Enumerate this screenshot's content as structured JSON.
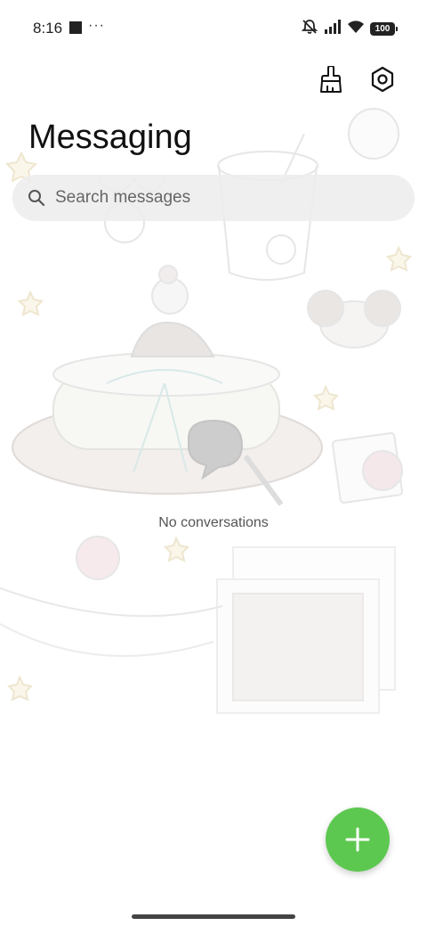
{
  "status_bar": {
    "time": "8:16",
    "more_indicator": "···",
    "battery": "100",
    "icons": [
      "notification-square-icon",
      "mute-icon",
      "signal-icon",
      "wifi-icon",
      "battery-icon"
    ]
  },
  "header": {
    "title": "Messaging",
    "actions": [
      {
        "icon": "brush-icon"
      },
      {
        "icon": "settings-icon"
      }
    ]
  },
  "search": {
    "placeholder": "Search messages",
    "icon": "search-icon"
  },
  "empty_state": {
    "text": "No conversations"
  },
  "fab": {
    "icon": "plus-icon",
    "color": "#5cc84f"
  },
  "colors": {
    "accent": "#5cc84f",
    "search_bg": "#ececec",
    "title": "#111111"
  }
}
